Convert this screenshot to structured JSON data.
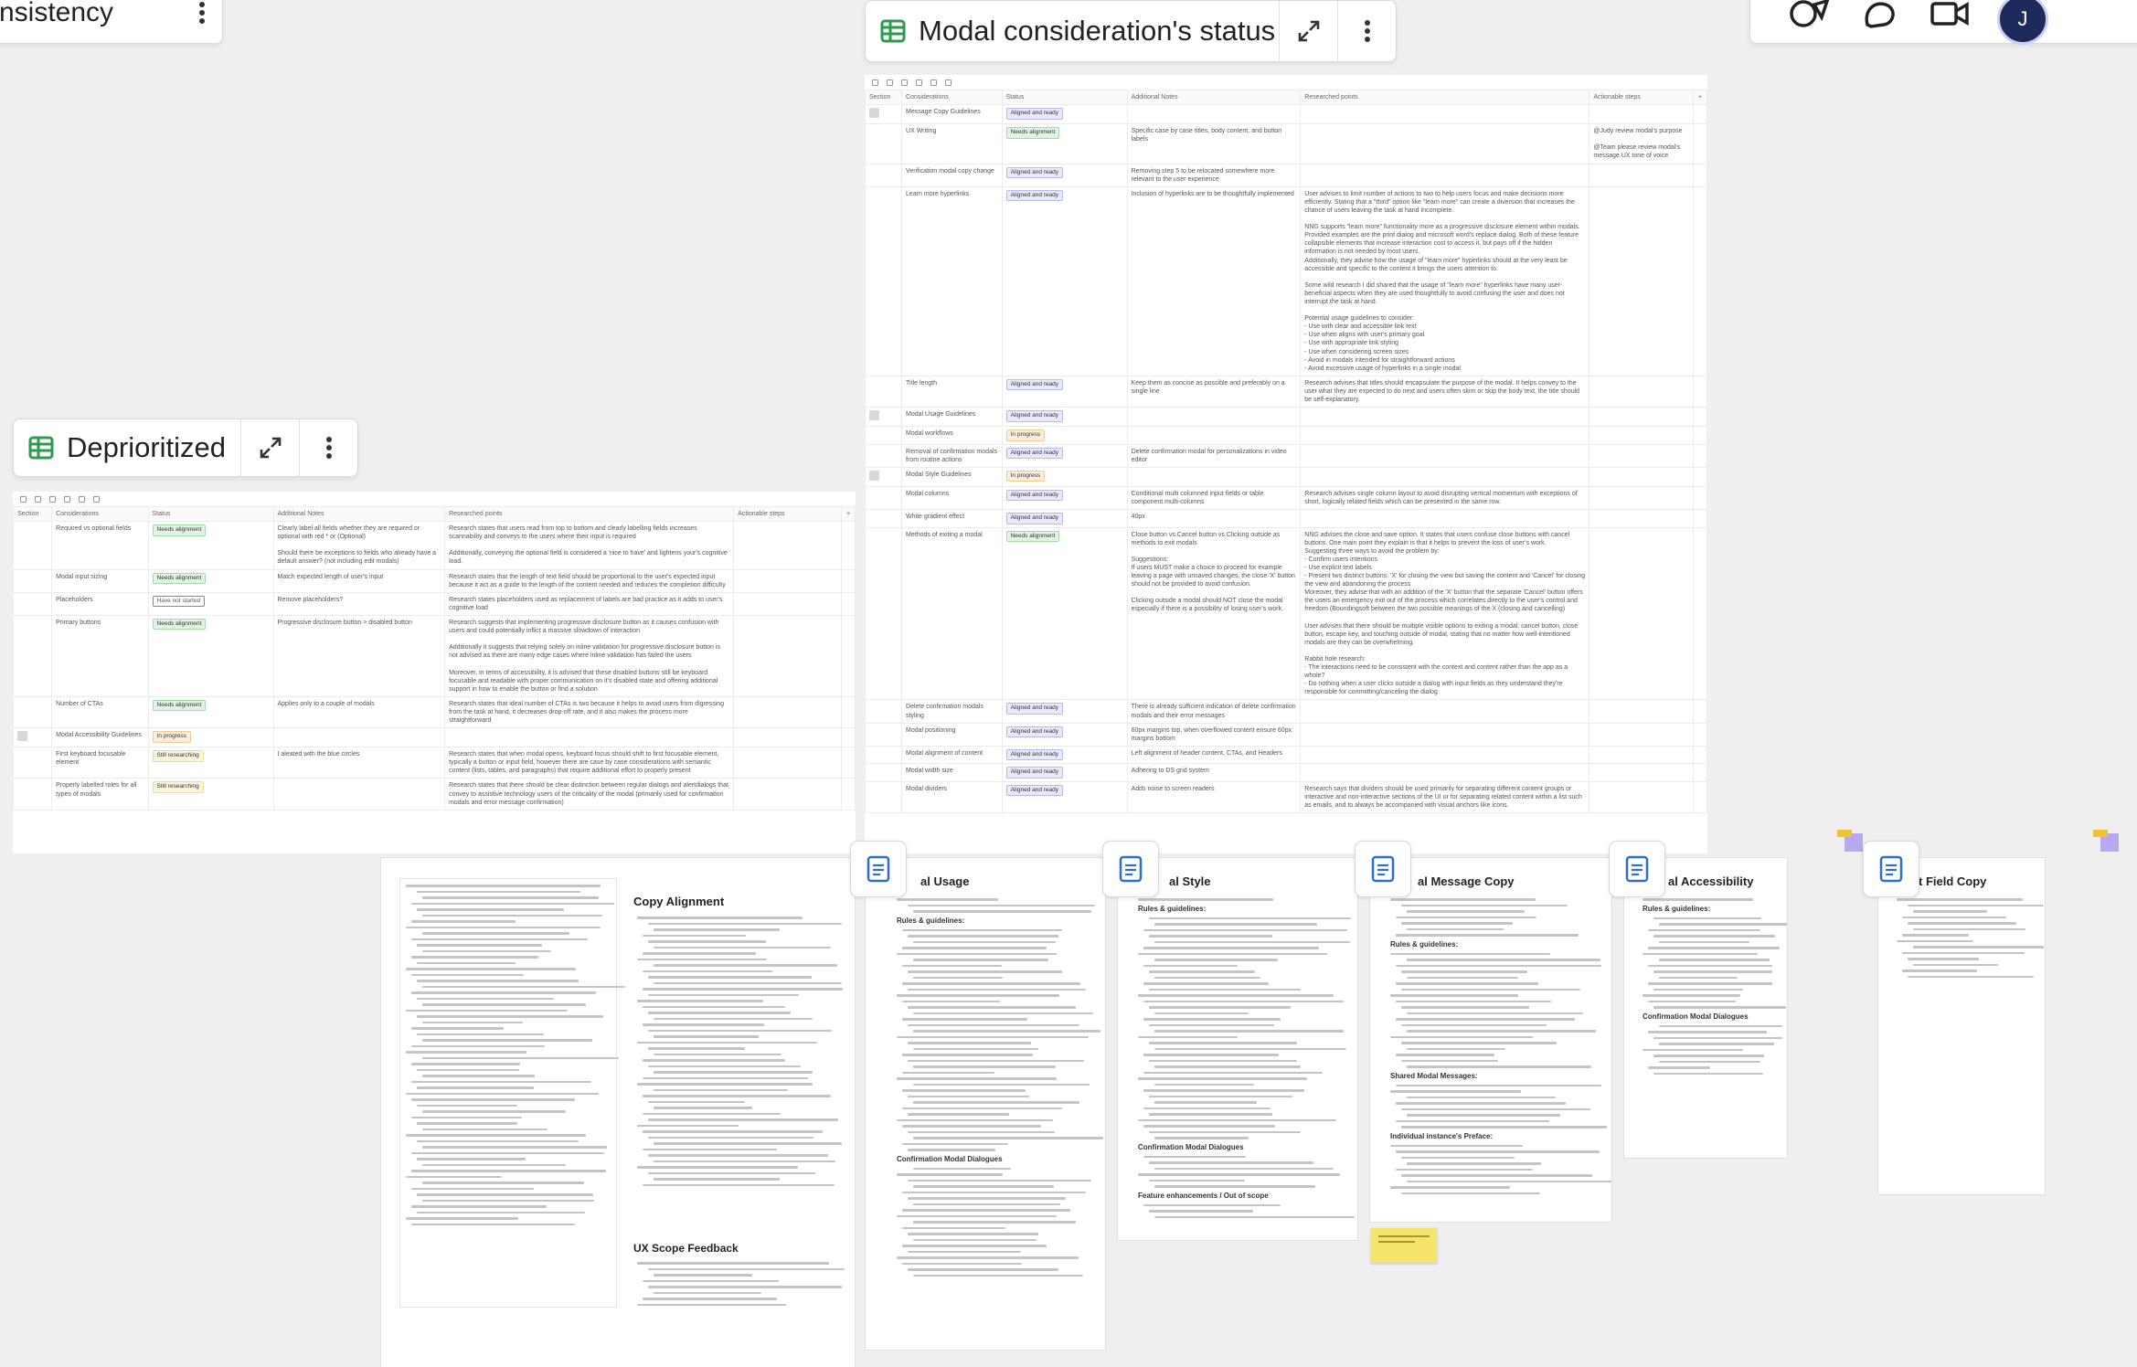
{
  "frames": {
    "partial_left_title": "nsistency",
    "modal_status": {
      "title": "Modal consideration's status"
    },
    "deprioritized": {
      "title": "Deprioritized"
    }
  },
  "table_columns": [
    "Section",
    "Considerations",
    "Status",
    "Additional Notes",
    "Researched points",
    "Actionable steps"
  ],
  "status_colors": {
    "Aligned and ready": "#8a8ff0",
    "Needs alignment": "#67c97a",
    "In progress": "#f0a855",
    "Still researching": "#e8c84a",
    "Have not started": "#888888"
  },
  "modal_rows": [
    {
      "c": "Message Copy Guidelines",
      "s": "Aligned and ready",
      "n": "",
      "r": "",
      "a": "",
      "section": true
    },
    {
      "c": "UX Writing",
      "s": "Needs alignment",
      "n": "Specific case by case titles, body content, and button labels",
      "r": "",
      "a": "@Judy review modal's purpose\n\n@Team please review modal's message UX tone of voice"
    },
    {
      "c": "Verification modal copy change",
      "s": "Aligned and ready",
      "n": "Removing step 5 to be relocated somewhere more relevant to the user experience",
      "r": "",
      "a": ""
    },
    {
      "c": "Learn more hyperlinks",
      "s": "Aligned and ready",
      "n": "Inclusion of hyperlinks are to be thoughtfully implemented",
      "r": "User advises to limit number of actions to two to help users focus and make decisions more efficiently. Stating that a \"third\" option like \"learn more\" can create a diversion that increases the chance of users leaving the task at hand incomplete.\n\nNNG supports \"learn more\" functionality more as a progressive disclosure element within modals. Provided examples are the print dialog and microsoft word's replace dialog. Both of these feature collapsible elements that increase interaction cost to access it, but pays off if the hidden information is not needed by most users.\nAdditionally, they advise how the usage of \"learn more\" hyperlinks should at the very least be accessible and specific to the content it brings the users attention to.\n\nSome wild research I did shared that the usage of \"learn more\" hyperlinks have many user-beneficial aspects when they are used thoughtfully to avoid confusing the user and does not interrupt the task at hand.\n\nPotential usage guidelines to consider:\n- Use with clear and accessible link text\n- Use when aligns with user's primary goal\n- Use with appropriate link styling\n- Use when considering screen sizes\n- Avoid in modals intended for straightforward actions\n- Avoid excessive usage of hyperlinks in a single modal",
      "a": ""
    },
    {
      "c": "Title length",
      "s": "Aligned and ready",
      "n": "Keep them as concise as possible and preferably on a single line",
      "r": "Research advises that titles should encapsulate the purpose of the modal. It helps convey to the user what they are expected to do next and users often skim or skip the body text, the title should be self-explanatory.",
      "a": ""
    },
    {
      "c": "Modal Usage Guidelines",
      "s": "Aligned and ready",
      "n": "",
      "r": "",
      "a": "",
      "section": true
    },
    {
      "c": "Modal workflows",
      "s": "In progress",
      "n": "",
      "r": "",
      "a": ""
    },
    {
      "c": "Removal of confirmation modals from routine actions",
      "s": "Aligned and ready",
      "n": "Delete confirmation modal for personalizations in video editor",
      "r": "",
      "a": ""
    },
    {
      "c": "Modal Style Guidelines",
      "s": "In progress",
      "n": "",
      "r": "",
      "a": "",
      "section": true
    },
    {
      "c": "Modal columns",
      "s": "Aligned and ready",
      "n": "Conditional multi columned input fields or table component multi-columns",
      "r": "Research advises single column layout to avoid disrupting vertical momentum with exceptions of short, logically related fields which can be presented in the same row.",
      "a": ""
    },
    {
      "c": "White gradient effect",
      "s": "Aligned and ready",
      "n": "40px",
      "r": "",
      "a": ""
    },
    {
      "c": "Methods of exiting a modal",
      "s": "Needs alignment",
      "n": "Close button vs Cancel button vs Clicking outside as methods to exit modals\n\nSuggestions:\nIf users MUST make a choice to proceed for example leaving a page with unsaved changes, the close 'X' button should not be provided to avoid confusion.\n\nClicking outside a modal should NOT close the modal especially if there is a possibility of losing user's work.",
      "r": "NNG advises the close and save option. It states that users confuse close buttons with cancel buttons. One main point they explain is that it helps to prevent the loss of user's work.\nSuggesting three ways to avoid the problem by:\n- Confirm users intentions\n- Use explicit text labels\n- Present two distinct buttons: 'X' for closing the view but saving the content and 'Cancel' for closing the view and abandoning the process\nMoreover, they advise that with an addition of the 'X' button that the separate 'Cancel' button offers the users an emergency exit out of the process which correlates directly to the user's control and freedom (Boundingsoft between the two possible meanings of the X (closing and cancelling)\n\nUser advises that there should be multiple visible options to exiting a modal: cancel button, close button, escape key, and touching outside of modal, stating that no matter how well-intentioned modals are they can be overwhelming.\n\nRabbit hole research:\n- The interactions need to be consistent with the context and content rather than the app as a whole?\n- Do nothing when a user clicks outside a dialog with input fields as they understand they're responsible for committing/canceling the dialog",
      "a": ""
    },
    {
      "c": "Delete confirmation modals styling",
      "s": "Aligned and ready",
      "n": "There is already sufficient indication of delete confirmation modals and their error messages",
      "r": "",
      "a": ""
    },
    {
      "c": "Modal positioning",
      "s": "Aligned and ready",
      "n": "60px margins top, when overflowed content ensure 60px margins bottom",
      "r": "",
      "a": ""
    },
    {
      "c": "Modal alignment of content",
      "s": "Aligned and ready",
      "n": "Left alignment of header content, CTAs, and Headers",
      "r": "",
      "a": ""
    },
    {
      "c": "Modal width size",
      "s": "Aligned and ready",
      "n": "Adhering to DS grid system",
      "r": "",
      "a": ""
    },
    {
      "c": "Modal dividers",
      "s": "Aligned and ready",
      "n": "Adds noise to screen readers",
      "r": "Research says that dividers should be used primarily for separating different content groups or interactive and non-interactive sections of the UI or for separating related content within a list such as emails, and to always be accompanied with visual anchors like icons.",
      "a": ""
    }
  ],
  "depr_rows": [
    {
      "c": "Required vs optional fields",
      "s": "Needs alignment",
      "n": "Clearly label all fields whether they are required or optional with red * or (Optional)\n\nShould there be exceptions to fields who already have a default answer? (not including edit modals)",
      "r": "Research states that users read from top to bottom and clearly labelling fields increases scannability and conveys to the users where their input is required\n\nAdditionally, conveying the optional field is considered a 'nice to have' and lightens your's cognitive load.",
      "a": ""
    },
    {
      "c": "Modal input sizing",
      "s": "Needs alignment",
      "n": "Match expected length of user's input",
      "r": "Research states that the length of text field should be proportional to the user's expected input because it act as a guide to the length of the content needed and reduces the completion difficulty",
      "a": ""
    },
    {
      "c": "Placeholders",
      "s": "Have not started",
      "n": "Remove placeholders?",
      "r": "Research states placeholders used as replacement of labels are bad practice as it adds to user's cognitive load",
      "a": ""
    },
    {
      "c": "Primary buttons",
      "s": "Needs alignment",
      "n": "Progressive disclosure button > disabled button",
      "r": "Research suggests that implementing progressive disclosure button as it causes confusion with users and could potentially inflict a massive slowdown of interaction\n\nAdditionally it suggests that relying solely on inline validation for progressive disclosure button is not advised as there are many edge cases where inline validation has failed the users\n\nMoreover, in terms of accessibility, it is advised that these disabled buttons still be keyboard focusable and readable with proper communication on it's disabled state and offering additional support in how to enable the button or find a solution",
      "a": ""
    },
    {
      "c": "Number of CTAs",
      "s": "Needs alignment",
      "n": "Applies only to a couple of modals",
      "r": "Research states that ideal number of CTAs is two because it helps to avoid users from digressing from the task at hand, it decreases drop-off rate, and it also makes the process more straightforward",
      "a": ""
    },
    {
      "c": "Modal Accessibility Guidelines",
      "s": "In progress",
      "n": "",
      "r": "",
      "a": "",
      "section": true
    },
    {
      "c": "First keyboard focusable element",
      "s": "Still researching",
      "n": "I aleated with the blue circles",
      "r": "Research states that when modal opens, keyboard focus should shift to first focusable element, typically a button or input field, however there are case by case considerations with semantic content (lists, tables, and paragraphs) that require additional effort to properly present",
      "a": ""
    },
    {
      "c": "Properly labelled roles for all types of modals",
      "s": "Still researching",
      "n": "",
      "r": "Research states that there should be clear distinction between regular dialogs and alertdialogs that convey to assistive technology users of the criticality of the modal (primarily used for confirmation modals and error message confirmation)",
      "a": ""
    }
  ],
  "docs": [
    {
      "title": "Copy Alignment"
    },
    {
      "title": "UX Scope Feedback"
    },
    {
      "title": "al Usage"
    },
    {
      "title": "al Style"
    },
    {
      "title": "al Message Copy"
    },
    {
      "title": "al Accessibility"
    },
    {
      "title": "t Field Copy"
    }
  ],
  "doc_snippets": {
    "rules": "Rules & guidelines:",
    "shared": "Shared Modal Messages:",
    "individual": "Individual instance's Preface:",
    "feature": "Feature enhancements / Out of scope",
    "confirmation": "Confirmation Modal Dialogues"
  },
  "icons": [
    "grid-icon",
    "expand-icon",
    "more-vertical-icon",
    "document-icon",
    "avatar"
  ]
}
